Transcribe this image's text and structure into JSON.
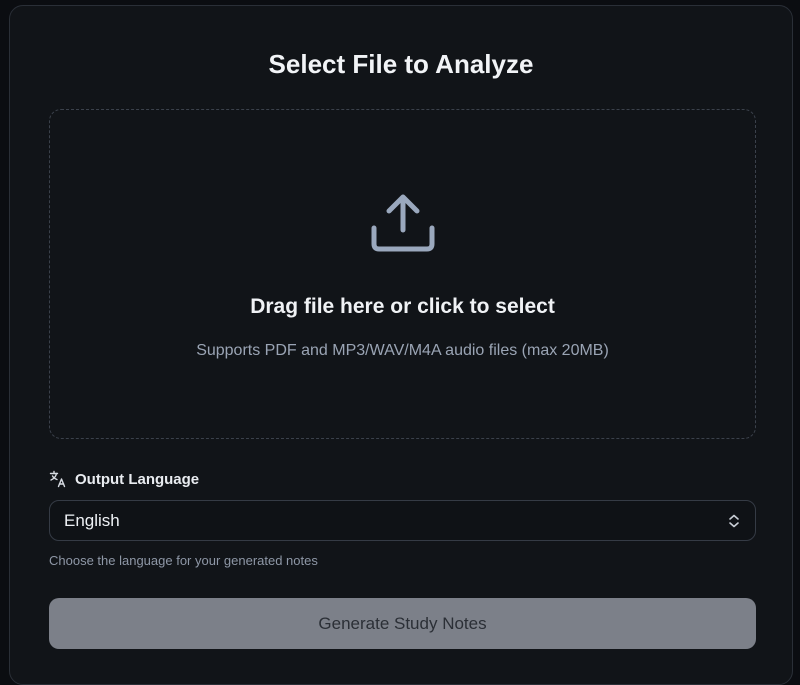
{
  "header": {
    "title": "Select File to Analyze"
  },
  "dropzone": {
    "icon": "upload-icon",
    "title": "Drag file here or click to select",
    "subtitle": "Supports PDF and MP3/WAV/M4A audio files (max 20MB)"
  },
  "language": {
    "icon": "translate-icon",
    "label": "Output Language",
    "selected": "English",
    "hint": "Choose the language for your generated notes"
  },
  "actions": {
    "generate_label": "Generate Study Notes",
    "generate_state": "disabled"
  },
  "colors": {
    "background": "#111418",
    "icon": "#9aa8bd",
    "button_disabled": "#7c8089"
  }
}
